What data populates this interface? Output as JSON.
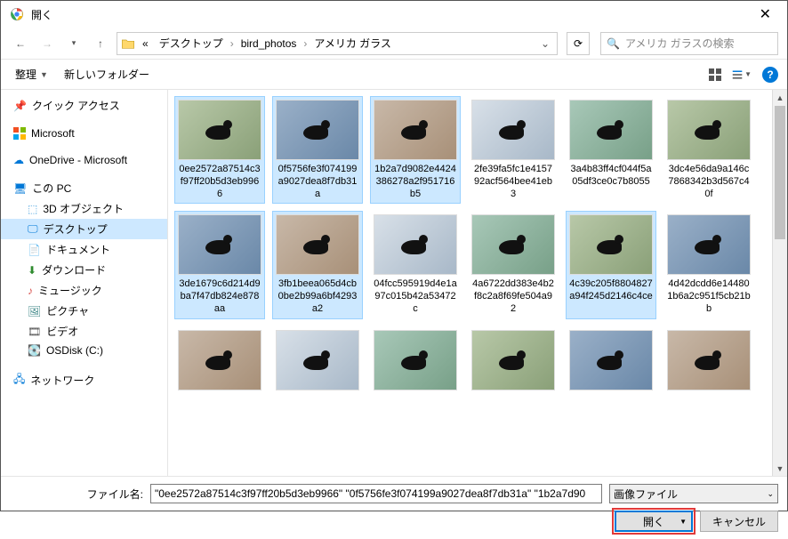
{
  "window": {
    "title": "開く"
  },
  "breadcrumb": {
    "prefix": "«",
    "items": [
      "デスクトップ",
      "bird_photos",
      "アメリカ ガラス"
    ]
  },
  "search": {
    "placeholder": "アメリカ ガラスの検索"
  },
  "toolbar": {
    "organize": "整理",
    "new_folder": "新しいフォルダー"
  },
  "sidebar": {
    "quick_access": "クイック アクセス",
    "microsoft": "Microsoft",
    "onedrive": "OneDrive - Microsoft",
    "this_pc": "この PC",
    "objects3d": "3D オブジェクト",
    "desktop": "デスクトップ",
    "documents": "ドキュメント",
    "downloads": "ダウンロード",
    "music": "ミュージック",
    "pictures": "ピクチャ",
    "videos": "ビデオ",
    "osdisk": "OSDisk (C:)",
    "network": "ネットワーク"
  },
  "files": [
    {
      "name": "0ee2572a87514c3f97ff20b5d3eb9966",
      "selected": true
    },
    {
      "name": "0f5756fe3f074199a9027dea8f7db31a",
      "selected": true
    },
    {
      "name": "1b2a7d9082e4424386278a2f951716b5",
      "selected": true
    },
    {
      "name": "2fe39fa5fc1e415792acf564bee41eb3",
      "selected": false
    },
    {
      "name": "3a4b83ff4cf044f5a05df3ce0c7b8055",
      "selected": false
    },
    {
      "name": "3dc4e56da9a146c7868342b3d567c40f",
      "selected": false
    },
    {
      "name": "3de1679c6d214d9ba7f47db824e878aa",
      "selected": true
    },
    {
      "name": "3fb1beea065d4cb0be2b99a6bf4293a2",
      "selected": true
    },
    {
      "name": "04fcc595919d4e1a97c015b42a53472c",
      "selected": false
    },
    {
      "name": "4a6722dd383e4b2f8c2a8f69fe504a92",
      "selected": false
    },
    {
      "name": "4c39c205f8804827a94f245d2146c4ce",
      "selected": true
    },
    {
      "name": "4d42dcdd6e144801b6a2c951f5cb21bb",
      "selected": false
    },
    {
      "name": "",
      "selected": false
    },
    {
      "name": "",
      "selected": false
    },
    {
      "name": "",
      "selected": false
    },
    {
      "name": "",
      "selected": false
    },
    {
      "name": "",
      "selected": false
    },
    {
      "name": "",
      "selected": false
    }
  ],
  "footer": {
    "filename_label": "ファイル名:",
    "filename_value": "\"0ee2572a87514c3f97ff20b5d3eb9966\" \"0f5756fe3f074199a9027dea8f7db31a\" \"1b2a7d90",
    "filetype": "画像ファイル",
    "open": "開く",
    "cancel": "キャンセル"
  }
}
